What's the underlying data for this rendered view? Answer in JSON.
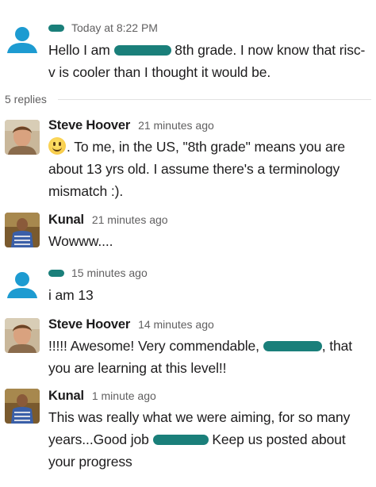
{
  "thread": {
    "parent": {
      "timestamp": "Today at 8:22 PM",
      "text_a": "Hello I am ",
      "text_b": " 8th grade. I now know that risc-v is cooler than I thought it would be."
    },
    "replies_label": "5 replies",
    "replies": [
      {
        "author": "Steve Hoover",
        "time": "21 minutes ago",
        "emoji": "slightly-smiling-face",
        "text": ". To me, in the US, \"8th grade\" means you are about 13 yrs old. I assume there's a terminology mismatch :)."
      },
      {
        "author": "Kunal",
        "time": "21 minutes ago",
        "text": "Wowww...."
      },
      {
        "author": "",
        "time": "15 minutes ago",
        "text": "i am 13"
      },
      {
        "author": "Steve Hoover",
        "time": "14 minutes ago",
        "text_a": "!!!!! Awesome! Very commendable, ",
        "text_b": ", that you are learning at this level!!"
      },
      {
        "author": "Kunal",
        "time": "1 minute ago",
        "text_a": "This was really what we were aiming, for so many years...Good job ",
        "text_b": " Keep us posted about your progress"
      }
    ]
  },
  "colors": {
    "redaction": "#1a7f7a",
    "default_avatar": "#1d9bd1",
    "timestamp": "#616061"
  }
}
